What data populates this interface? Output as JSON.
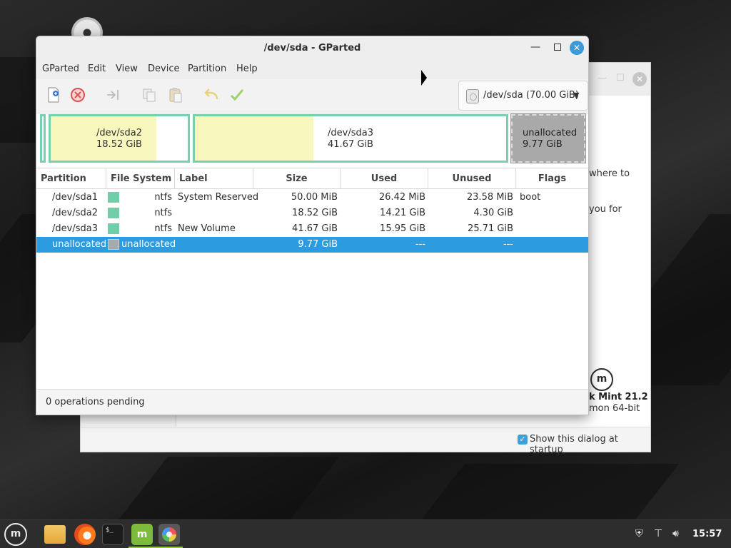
{
  "desktop": {},
  "welcome": {
    "text_where": "where to",
    "text_thanks": "you for",
    "os_name": "k Mint 21.2",
    "os_edition": "mon 64-bit",
    "startup_label": "Show this dialog at startup",
    "startup_checked": true
  },
  "gparted": {
    "title": "/dev/sda - GParted",
    "menu": [
      "GParted",
      "Edit",
      "View",
      "Device",
      "Partition",
      "Help"
    ],
    "toolbar": {
      "icons": [
        "new-partition-icon",
        "delete-partition-icon",
        "apply-resize-icon",
        "copy-icon",
        "paste-icon",
        "undo-icon",
        "apply-icon"
      ]
    },
    "device": "/dev/sda (70.00 GiB)",
    "map": {
      "sda2": {
        "name": "/dev/sda2",
        "size": "18.52 GiB",
        "used_fraction": 0.77
      },
      "sda3": {
        "name": "/dev/sda3",
        "size": "41.67 GiB",
        "used_fraction": 0.38
      },
      "unallocated": {
        "name": "unallocated",
        "size": "9.77 GiB"
      }
    },
    "columns": [
      "Partition",
      "File System",
      "Label",
      "Size",
      "Used",
      "Unused",
      "Flags"
    ],
    "rows": [
      {
        "partition": "/dev/sda1",
        "fs": "ntfs",
        "label": "System Reserved",
        "size": "50.00 MiB",
        "used": "26.42 MiB",
        "unused": "23.58 MiB",
        "flags": "boot"
      },
      {
        "partition": "/dev/sda2",
        "fs": "ntfs",
        "label": "",
        "size": "18.52 GiB",
        "used": "14.21 GiB",
        "unused": "4.30 GiB",
        "flags": ""
      },
      {
        "partition": "/dev/sda3",
        "fs": "ntfs",
        "label": "New Volume",
        "size": "41.67 GiB",
        "used": "15.95 GiB",
        "unused": "25.71 GiB",
        "flags": ""
      },
      {
        "partition": "unallocated",
        "fs": "unallocated",
        "label": "",
        "size": "9.77 GiB",
        "used": "---",
        "unused": "---",
        "flags": ""
      }
    ],
    "status": "0 operations pending",
    "colors": {
      "ntfs": "#6fcfa8",
      "unallocated": "#a9a9a9",
      "selection": "#2c9be0"
    }
  },
  "taskbar": {
    "items": [
      "menu-icon",
      "files-icon",
      "firefox-icon",
      "terminal-icon",
      "mintinstall-icon",
      "gparted-icon"
    ],
    "clock": "15:57"
  }
}
